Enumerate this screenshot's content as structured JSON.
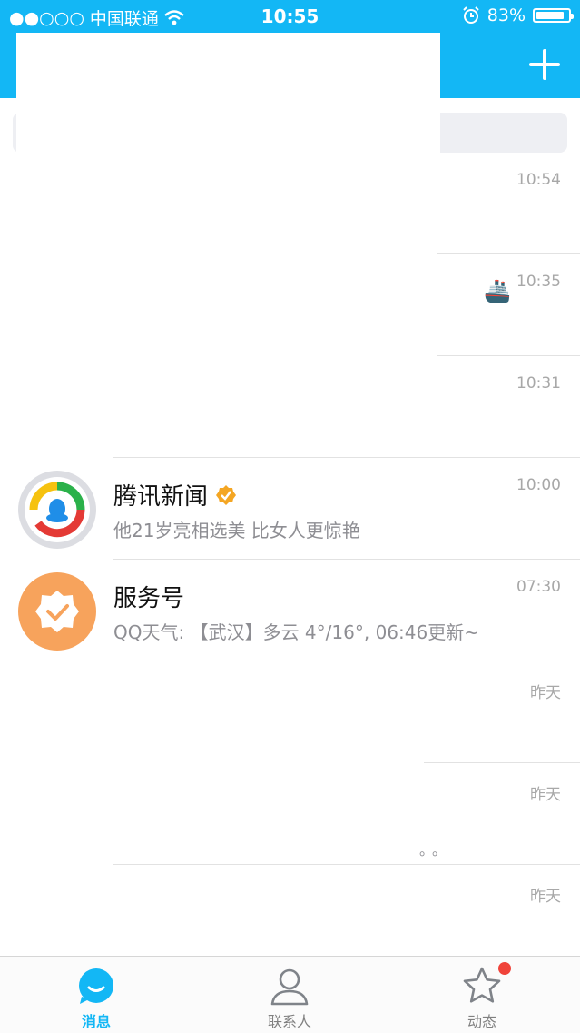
{
  "status_bar": {
    "signal": "●●○○○",
    "carrier": "中国联通",
    "time": "10:55",
    "battery": "83%"
  },
  "colors": {
    "accent": "#13b7f5",
    "badge": "#f0433a",
    "orange": "#f7a35c"
  },
  "conversations": [
    {
      "time": "10:54"
    },
    {
      "time": "10:35"
    },
    {
      "time": "10:31"
    },
    {
      "title": "腾讯新闻",
      "message": "他21岁亮相选美 比女人更惊艳",
      "time": "10:00"
    },
    {
      "title": "服务号",
      "message": "QQ天气: 【武汉】多云 4°/16°, 06:46更新~",
      "time": "07:30"
    },
    {
      "time": "昨天"
    },
    {
      "time": "昨天",
      "message": "。。"
    },
    {
      "time": "昨天"
    }
  ],
  "tabs": [
    {
      "label": "消息"
    },
    {
      "label": "联系人"
    },
    {
      "label": "动态"
    }
  ]
}
